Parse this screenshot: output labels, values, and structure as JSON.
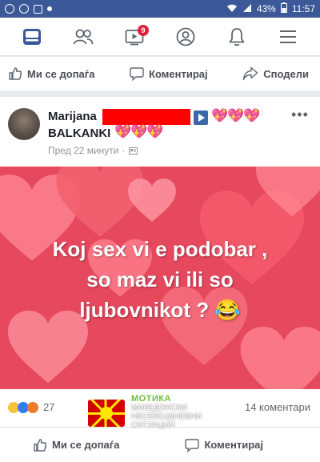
{
  "statusbar": {
    "battery": "43%",
    "time": "11:57"
  },
  "nav": {
    "notification_count": "9"
  },
  "actionbar": {
    "like": "Ми се допаѓа",
    "comment": "Коментирај",
    "share": "Сподели"
  },
  "post": {
    "author_first": "Marijana",
    "author_second": "BALKANKI",
    "hearts": "💖💖💖",
    "time": "Пред 22 минути",
    "image_lines": [
      "Koj sex vi e podobar ,",
      "so maz vi ili so",
      "ljubovnikot ? 😂"
    ],
    "reaction_count": "27",
    "comments": "14 коментари",
    "like_label": "Ми се допаѓа",
    "comment_label": "Коментирај"
  },
  "watermark": {
    "title": "МОТИКА",
    "line1": "МАКЕДОНСКИ",
    "line2": "НЕСЕКОЈДНЕВНИ",
    "line3": "СИТУАЦИИ"
  },
  "colors": {
    "fb_blue": "#3b5998",
    "image_bg": "#e6485d",
    "redaction": "#ff0000"
  }
}
